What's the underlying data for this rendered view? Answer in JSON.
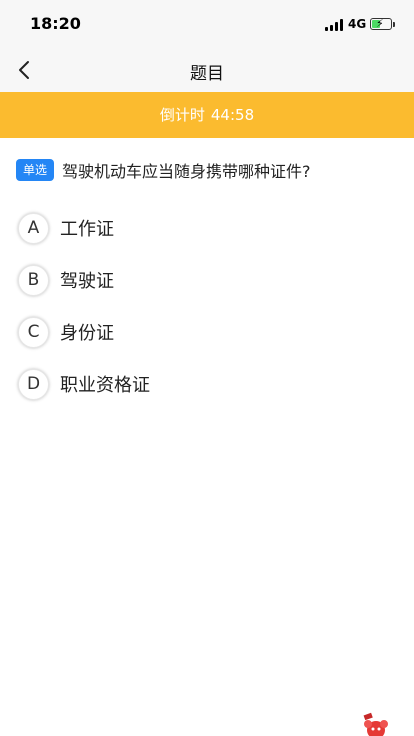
{
  "status": {
    "time": "18:20",
    "network": "4G"
  },
  "nav": {
    "title": "题目",
    "back_icon": "chevron-left-icon"
  },
  "timer": {
    "label": "倒计时",
    "value": "44:58",
    "color": "#fbbb2f"
  },
  "question": {
    "type": "单选",
    "text": "驾驶机动车应当随身携带哪种证件?",
    "options": [
      {
        "letter": "A",
        "text": "工作证"
      },
      {
        "letter": "B",
        "text": "驾驶证"
      },
      {
        "letter": "C",
        "text": "身份证"
      },
      {
        "letter": "D",
        "text": "职业资格证"
      }
    ]
  },
  "colors": {
    "accent_blue": "#2486f5",
    "battery_green": "#4cd964"
  }
}
